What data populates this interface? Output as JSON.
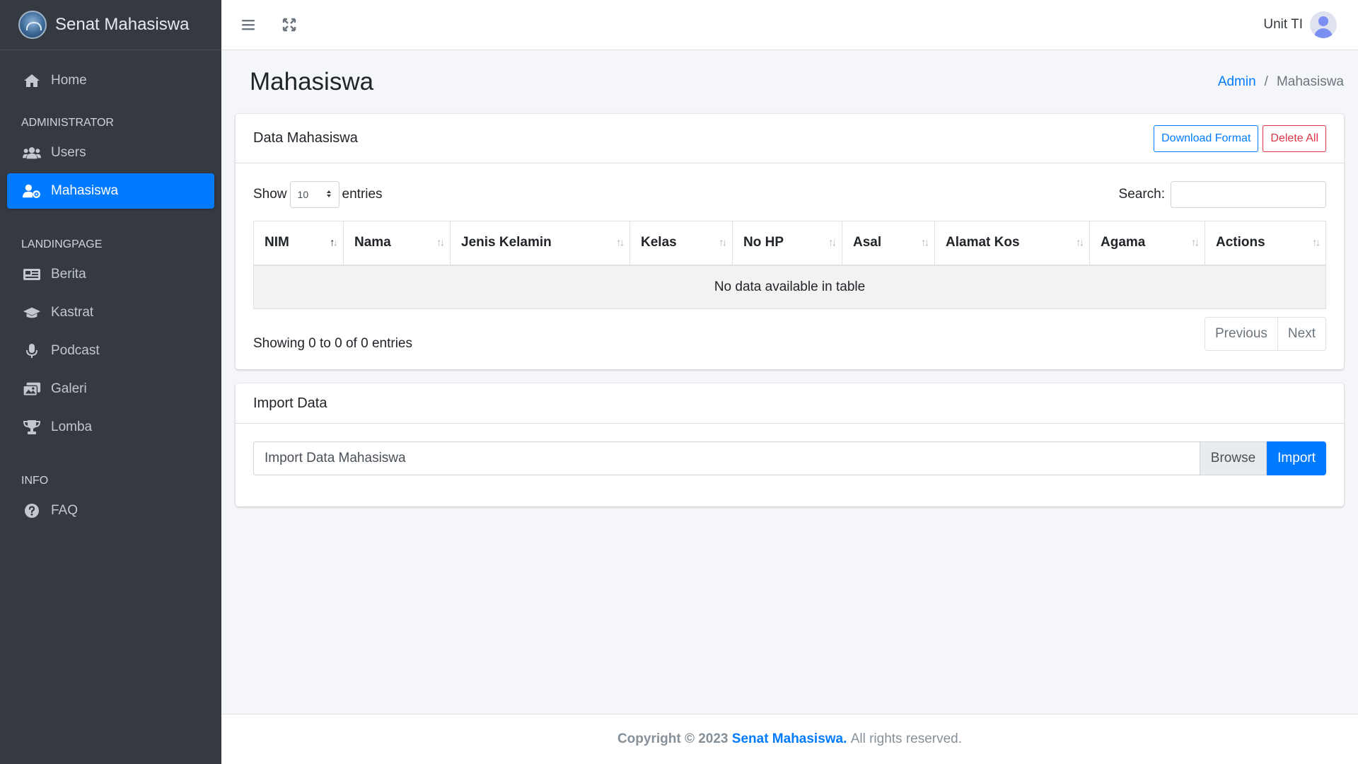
{
  "brand": {
    "name": "Senat Mahasiswa"
  },
  "sidebar": {
    "home": "Home",
    "sections": {
      "administrator": "ADMINISTRATOR",
      "landingpage": "LANDINGPAGE",
      "info": "INFO"
    },
    "items": {
      "users": "Users",
      "mahasiswa": "Mahasiswa",
      "berita": "Berita",
      "kastrat": "Kastrat",
      "podcast": "Podcast",
      "galeri": "Galeri",
      "lomba": "Lomba",
      "faq": "FAQ"
    },
    "active": "mahasiswa"
  },
  "topbar": {
    "user_name": "Unit TI",
    "icons": [
      "menu-icon",
      "expand-icon",
      "avatar"
    ]
  },
  "page": {
    "title": "Mahasiswa",
    "breadcrumb": {
      "root": "Admin",
      "sep": "/",
      "current": "Mahasiswa"
    }
  },
  "data_card": {
    "title": "Data Mahasiswa",
    "download_label": "Download Format",
    "delete_label": "Delete All",
    "show_label": "Show",
    "entries_value": "10",
    "entries_label": "entries",
    "search_label": "Search:",
    "search_value": "",
    "columns": [
      "NIM",
      "Nama",
      "Jenis Kelamin",
      "Kelas",
      "No HP",
      "Asal",
      "Alamat Kos",
      "Agama",
      "Actions"
    ],
    "empty_text": "No data available in table",
    "info_text": "Showing 0 to 0 of 0 entries",
    "prev_label": "Previous",
    "next_label": "Next"
  },
  "import_card": {
    "title": "Import Data",
    "file_placeholder": "Import Data Mahasiswa",
    "browse_label": "Browse",
    "import_label": "Import"
  },
  "footer": {
    "prefix": "Copyright © 2023",
    "brand": "Senat Mahasiswa.",
    "suffix": "All rights reserved."
  },
  "colors": {
    "primary": "#007bff",
    "danger": "#dc3545",
    "sidebar": "#343a40"
  }
}
